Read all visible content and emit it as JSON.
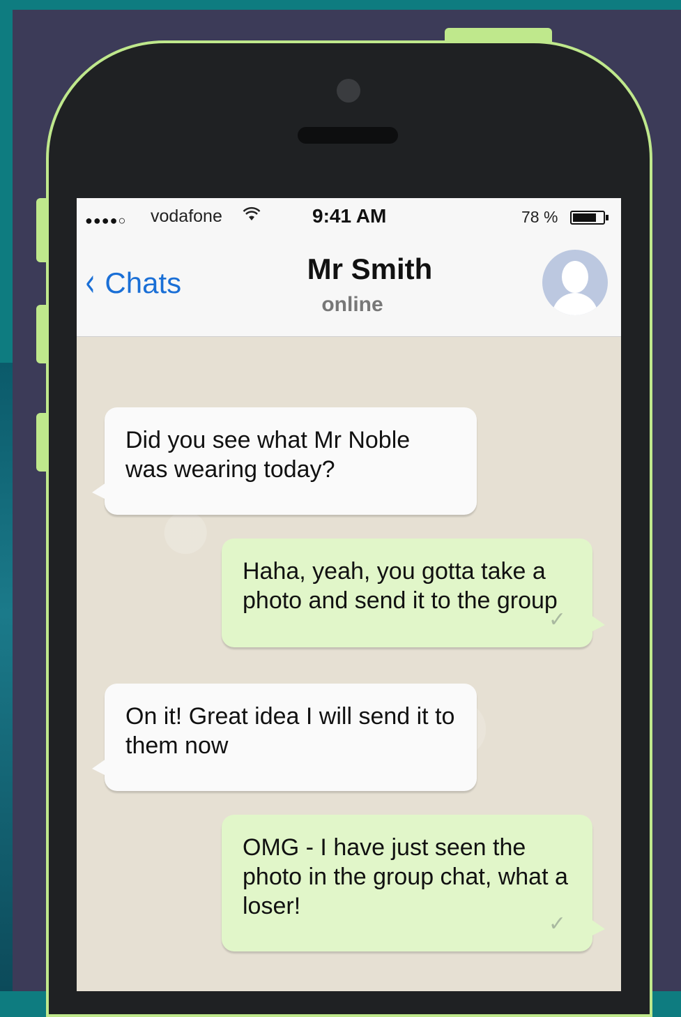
{
  "status_bar": {
    "signal": "●●●●○",
    "carrier": "vodafone",
    "time": "9:41 AM",
    "battery_percent": "78 %",
    "battery_level": 0.78
  },
  "nav_bar": {
    "back_label": "Chats",
    "contact_name": "Mr Smith",
    "contact_status": "online"
  },
  "messages": [
    {
      "direction": "incoming",
      "text": "Did you see what Mr Noble was wearing today?"
    },
    {
      "direction": "outgoing",
      "text": "Haha, yeah, you gotta take a photo and send it to the group",
      "status": "✓"
    },
    {
      "direction": "incoming",
      "text": "On it! Great idea I will send it to them now"
    },
    {
      "direction": "outgoing",
      "text": "OMG - I have just seen the photo in the group chat, what a loser!",
      "status": "✓"
    }
  ],
  "icons": {
    "wifi": "wifi-icon",
    "back": "chevron-left-icon",
    "avatar": "avatar-placeholder-icon"
  },
  "colors": {
    "accent": "#1a6fd6",
    "phone_border": "#bfe88c",
    "outgoing_bubble": "#e1f6c9",
    "incoming_bubble": "#fafafa"
  }
}
